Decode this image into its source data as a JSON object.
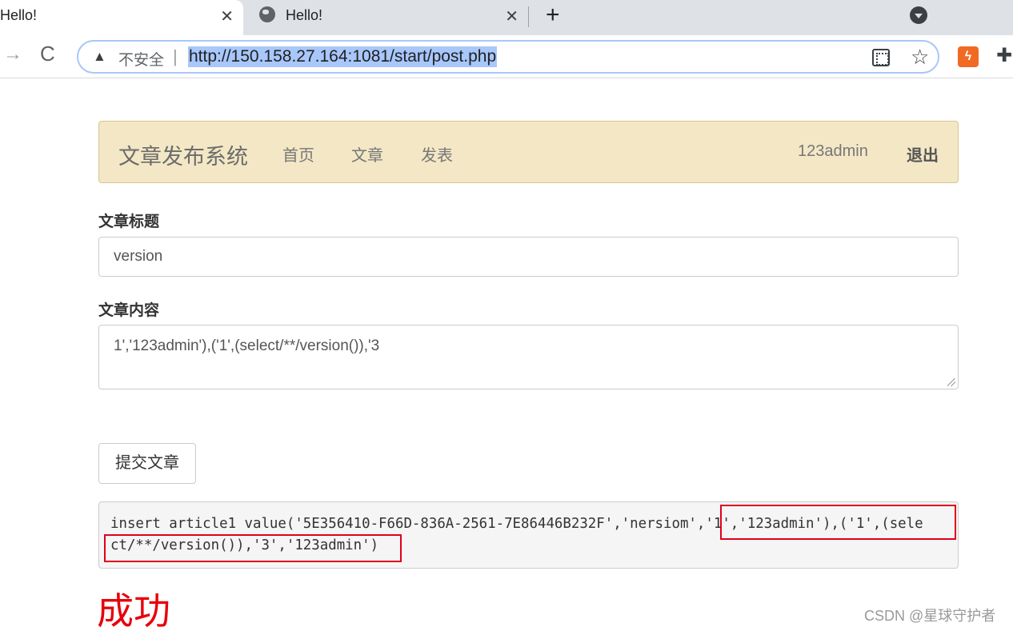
{
  "browser": {
    "tabs": [
      {
        "title": "Hello!",
        "close": "✕"
      },
      {
        "title": "Hello!",
        "close": "✕"
      }
    ],
    "new_tab": "+",
    "toolbar": {
      "forward": "→",
      "reload": "C",
      "security_icon": "▲",
      "security_label": "不安全",
      "separator": "|",
      "url": "http://150.158.27.164:1081/start/post.php",
      "bookmark": "☆",
      "extension_badge": "ϟ",
      "extensions": "✚"
    },
    "icons": [
      "globe-icon",
      "profile-icon",
      "qr-icon",
      "star-icon",
      "puzzle-icon"
    ]
  },
  "navbar": {
    "brand": "文章发布系统",
    "links": [
      "首页",
      "文章",
      "发表"
    ],
    "user": "123admin",
    "logout": "退出"
  },
  "form": {
    "title_label": "文章标题",
    "title_value": "version",
    "content_label": "文章内容",
    "content_value": "1','123admin'),('1',(select/**/version()),'3",
    "submit": "提交文章"
  },
  "result": {
    "sql_line1": "insert article1 value('5E356410-F66D-836A-2561-7E86446B232F','nersiom','1','123admin'),('1',(sele",
    "sql_line2": "ct/**/version()),'3','123admin')",
    "highlight_color": "#e0001b",
    "status": "成功"
  },
  "watermark": "CSDN @星球守护者"
}
